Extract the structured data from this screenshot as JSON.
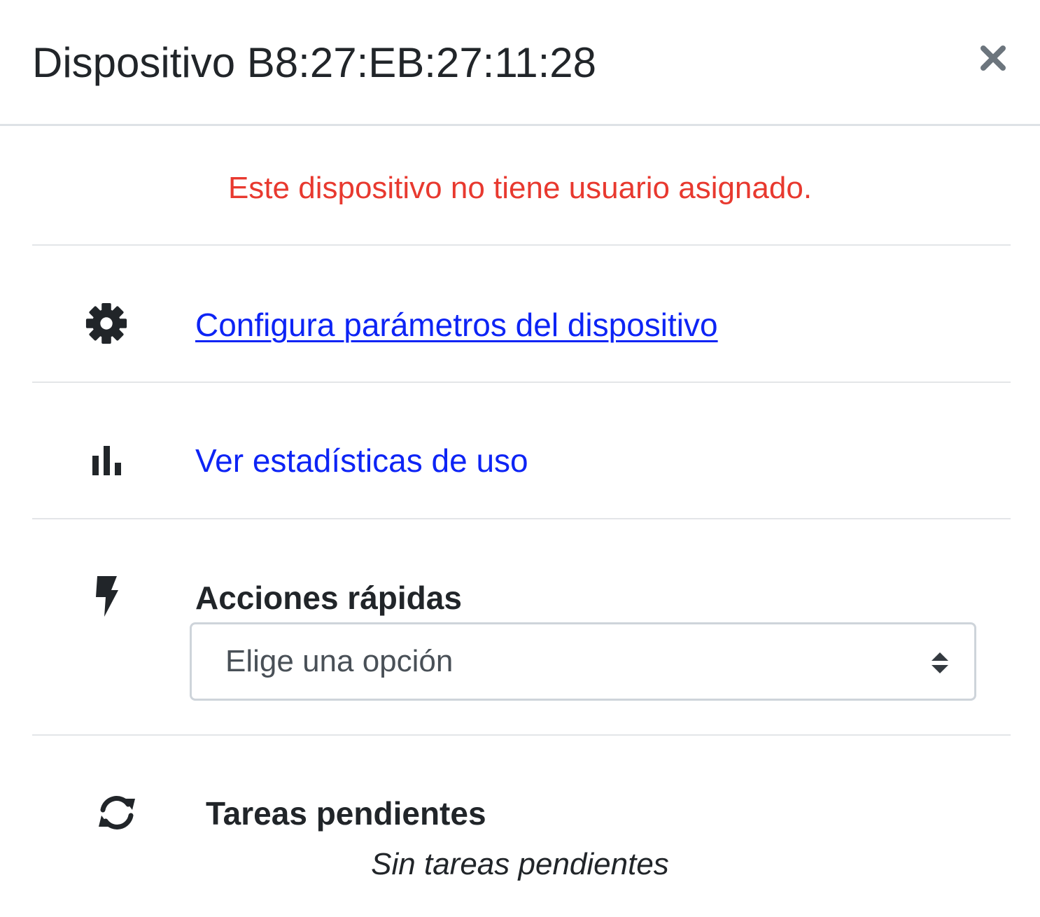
{
  "modal": {
    "title": "Dispositivo B8:27:EB:27:11:28",
    "close_icon": "close-icon"
  },
  "warning_text": "Este dispositivo no tiene usuario asignado.",
  "colors": {
    "warning": "#e8392f",
    "link": "#0d24f5",
    "text": "#212529",
    "divider": "#e3e5e8",
    "select_border": "#ced4da"
  },
  "rows": {
    "configure": {
      "icon": "gear-icon",
      "label": "Configura parámetros del dispositivo"
    },
    "stats": {
      "icon": "bar-chart-icon",
      "label": "Ver estadísticas de uso"
    },
    "quick_actions": {
      "icon": "bolt-icon",
      "label": "Acciones rápidas",
      "select_value": "Elige una opción"
    },
    "pending_tasks": {
      "icon": "sync-icon",
      "label": "Tareas pendientes",
      "empty_text": "Sin tareas pendientes"
    }
  }
}
